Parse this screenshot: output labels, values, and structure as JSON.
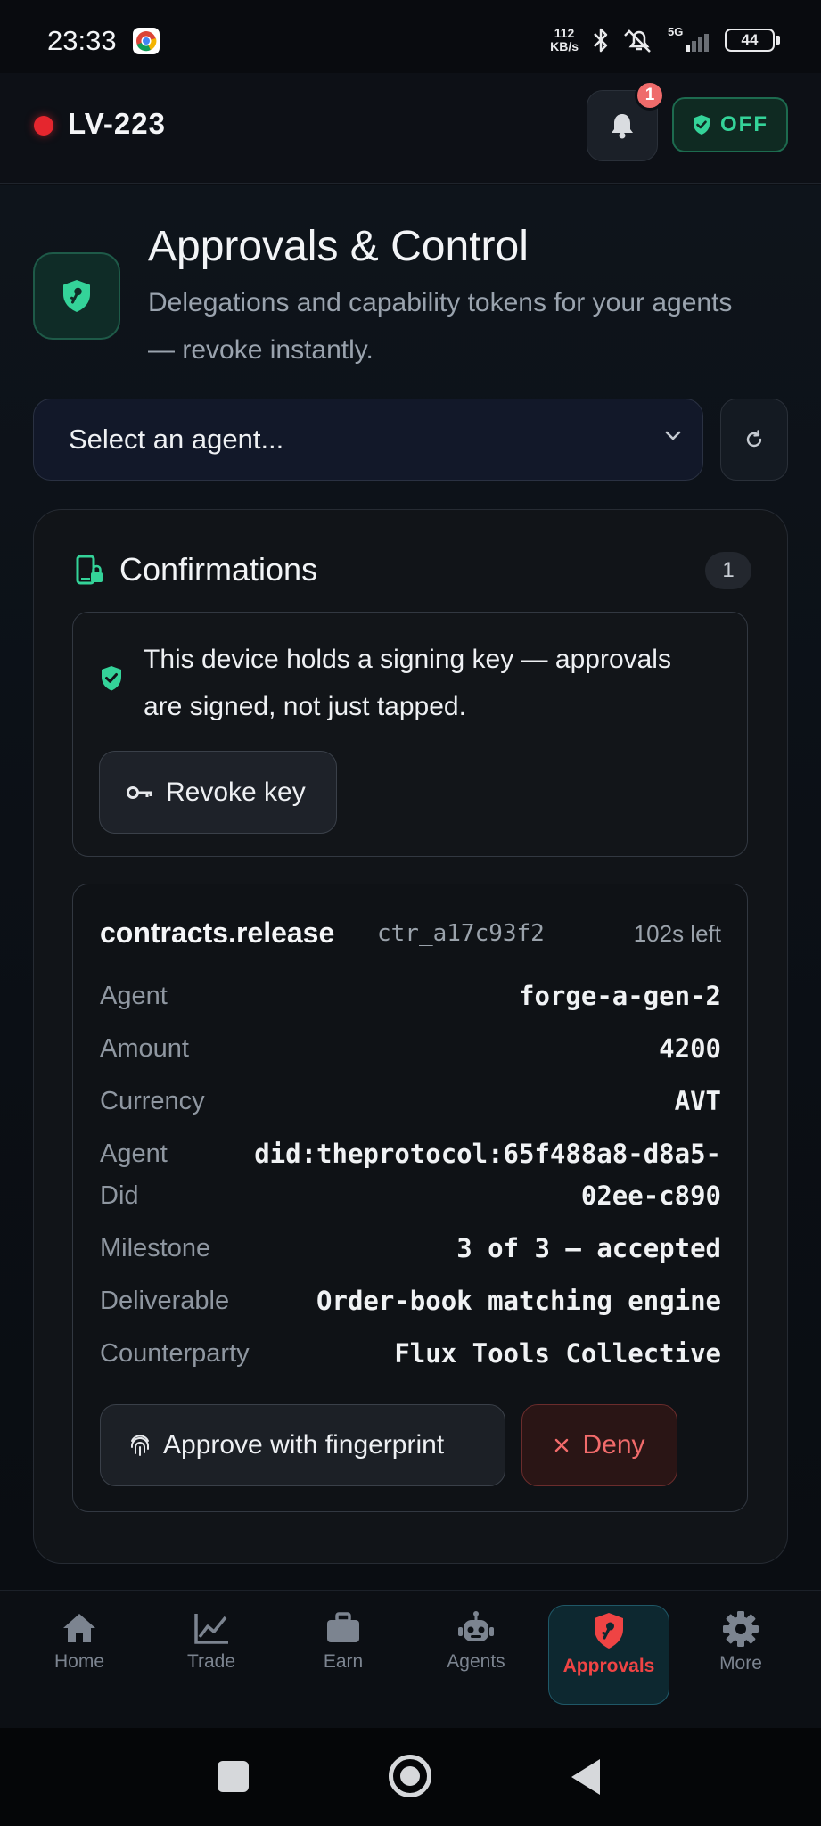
{
  "status_bar": {
    "time": "23:33",
    "net_speed_value": "112",
    "net_speed_unit": "KB/s",
    "network": "5G",
    "battery": "44",
    "icons": [
      "chrome-icon",
      "bluetooth-icon",
      "mute-alarm-icon",
      "signal-icon",
      "battery-icon"
    ]
  },
  "header": {
    "device_id": "LV-223",
    "live_dot_color": "#e5262e",
    "notifications_count": "1",
    "kill_switch_label": "OFF"
  },
  "page": {
    "title": "Approvals & Control",
    "subtitle": "Delegations and capability tokens for your agents — revoke instantly."
  },
  "agent_select": {
    "placeholder": "Select an agent..."
  },
  "confirmations": {
    "title": "Confirmations",
    "count": "1",
    "notice": "This device holds a signing key — approvals are signed, not just tapped.",
    "revoke_label": "Revoke key",
    "request": {
      "action": "contracts.release",
      "id": "ctr_a17c93f2",
      "ttl": "102s left",
      "rows": [
        {
          "label": "Agent",
          "value": "forge-a-gen-2"
        },
        {
          "label": "Amount",
          "value": "4200"
        },
        {
          "label": "Currency",
          "value": "AVT"
        },
        {
          "label": "Agent Did",
          "value": "did:theprotocol:65f488a8-d8a5-02ee-c890"
        },
        {
          "label": "Milestone",
          "value": "3 of 3 — accepted"
        },
        {
          "label": "Deliverable",
          "value": "Order-book matching engine"
        },
        {
          "label": "Counterparty",
          "value": "Flux Tools Collective"
        }
      ],
      "approve_label": "Approve with fingerprint",
      "deny_label": "Deny"
    }
  },
  "nav": {
    "items": [
      {
        "label": "Home",
        "icon": "home-icon"
      },
      {
        "label": "Trade",
        "icon": "chart-icon"
      },
      {
        "label": "Earn",
        "icon": "briefcase-icon"
      },
      {
        "label": "Agents",
        "icon": "robot-icon"
      },
      {
        "label": "Approvals",
        "icon": "shield-key-icon"
      },
      {
        "label": "More",
        "icon": "gear-icon"
      }
    ],
    "active": "Approvals"
  },
  "colors": {
    "accent_green": "#34d399",
    "danger_red": "#ef4444",
    "background": "#0b0e13"
  }
}
